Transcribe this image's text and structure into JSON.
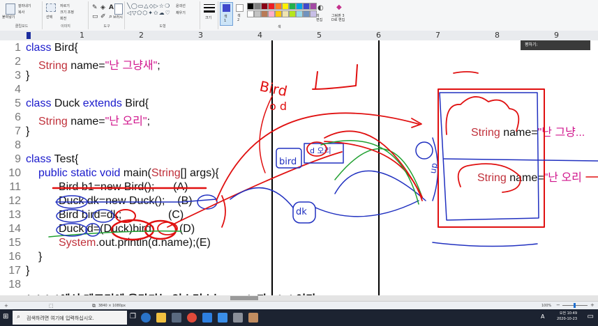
{
  "ribbon": {
    "clipboard": {
      "paste": "붙여넣기",
      "cut": "잘라내기",
      "copy": "복사",
      "group": "클립보드"
    },
    "image": {
      "select": "선택",
      "crop": "자르기",
      "resize": "크기 조정",
      "rotate": "회전",
      "group": "이미지"
    },
    "tools": {
      "group": "도구"
    },
    "shapes": {
      "brushes": "브러시",
      "outline": "윤곽선",
      "fill": "채우기",
      "group": "도형"
    },
    "size": {
      "label": "크기"
    },
    "color1": {
      "label": "색\n1"
    },
    "color2": {
      "label": "색\n2"
    },
    "edit_colors": "색\n편집",
    "paint3d": "그림판 3\nD로 편집",
    "colors_group": "색",
    "palette": [
      "#000000",
      "#7f7f7f",
      "#880015",
      "#ed1c24",
      "#ff7f27",
      "#fff200",
      "#22b14c",
      "#00a2e8",
      "#3f48cc",
      "#a349a4",
      "#ffffff",
      "#c3c3c3",
      "#b97a57",
      "#ffaec9",
      "#ffc90e",
      "#efe4b0",
      "#b5e61d",
      "#99d9ea",
      "#7092be",
      "#c8bfe7"
    ],
    "active_color": "#3f48cc"
  },
  "ruler": {
    "numbers": [
      "1",
      "2",
      "3",
      "4",
      "5",
      "6",
      "7",
      "8",
      "9"
    ]
  },
  "tooltip": {
    "text": "평하기:"
  },
  "code": {
    "line_numbers": [
      "1",
      "2",
      "3",
      "4",
      "5",
      "6",
      "7",
      "8",
      "9",
      "10",
      "11",
      "12",
      "13",
      "14",
      "15",
      "16",
      "17",
      "18"
    ],
    "l1_kw": "class",
    "l1_rest": " Bird{",
    "l2_type": "String",
    "l2_mid": " name=",
    "l2_str": "\"난 그냥새\"",
    "l2_end": ";",
    "l3": "}",
    "l5_kw": "class",
    "l5_mid": " Duck ",
    "l5_kw2": "extends",
    "l5_end": " Bird{",
    "l6_type": "String",
    "l6_mid": " name=",
    "l6_str": "\"난 오리\"",
    "l6_end": ";",
    "l7": "}",
    "l9_kw": "class",
    "l9_rest": " Test{",
    "l10_kw": "public static void",
    "l10_mid": " main(",
    "l10_type": "String",
    "l10_end": "[] args){",
    "l11": "Bird b1=new Bird();      (A)",
    "l12": "Duck dk=new Duck();    (B)",
    "l13": "Bird bird=dk;               (C)",
    "l14": "Duck d=(Duck)bird;        (D)",
    "l15_type": "System",
    "l15_rest": ".out.println(d.name);(E)",
    "l16": "}",
    "l17": "}",
    "l19": "(A) (A)에서 메모리에 올라가는 인스턴스는 Duck 과 Bird 이다"
  },
  "heap": {
    "box1": {
      "type": "String",
      "mid": " name=",
      "str": "\"난 그냥..."
    },
    "box2": {
      "type": "String",
      "mid": " name=",
      "str": "\"난 오리"
    }
  },
  "status": {
    "dimensions": "3840 × 1080px",
    "zoom": "100%"
  },
  "taskbar": {
    "search_placeholder": "검색하려면 여기에 입력하십시오.",
    "time": "오전 10:49",
    "date": "2020-10-23",
    "lang": "A"
  }
}
